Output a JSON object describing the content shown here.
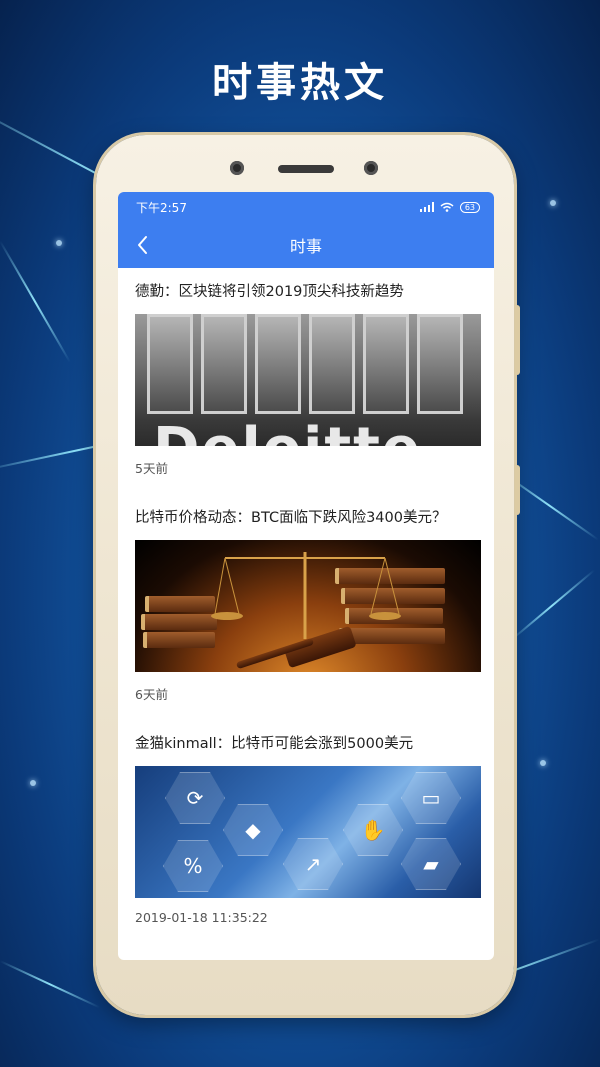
{
  "headline": "时事热文",
  "status_bar": {
    "time": "下午2:57",
    "battery": "63"
  },
  "nav": {
    "title": "时事"
  },
  "articles": [
    {
      "title": "德勤：区块链将引领2019顶尖科技新趋势",
      "time": "5天前",
      "image_sign": "Deloitte"
    },
    {
      "title": "比特币价格动态：BTC面临下跌风险3400美元？",
      "time": "6天前"
    },
    {
      "title": "金猫kinmall：比特币可能会涨到5000美元",
      "time": "2019-01-18 11:35:22"
    }
  ],
  "colors": {
    "accent": "#3d7ef0",
    "background": "#145aa8"
  }
}
